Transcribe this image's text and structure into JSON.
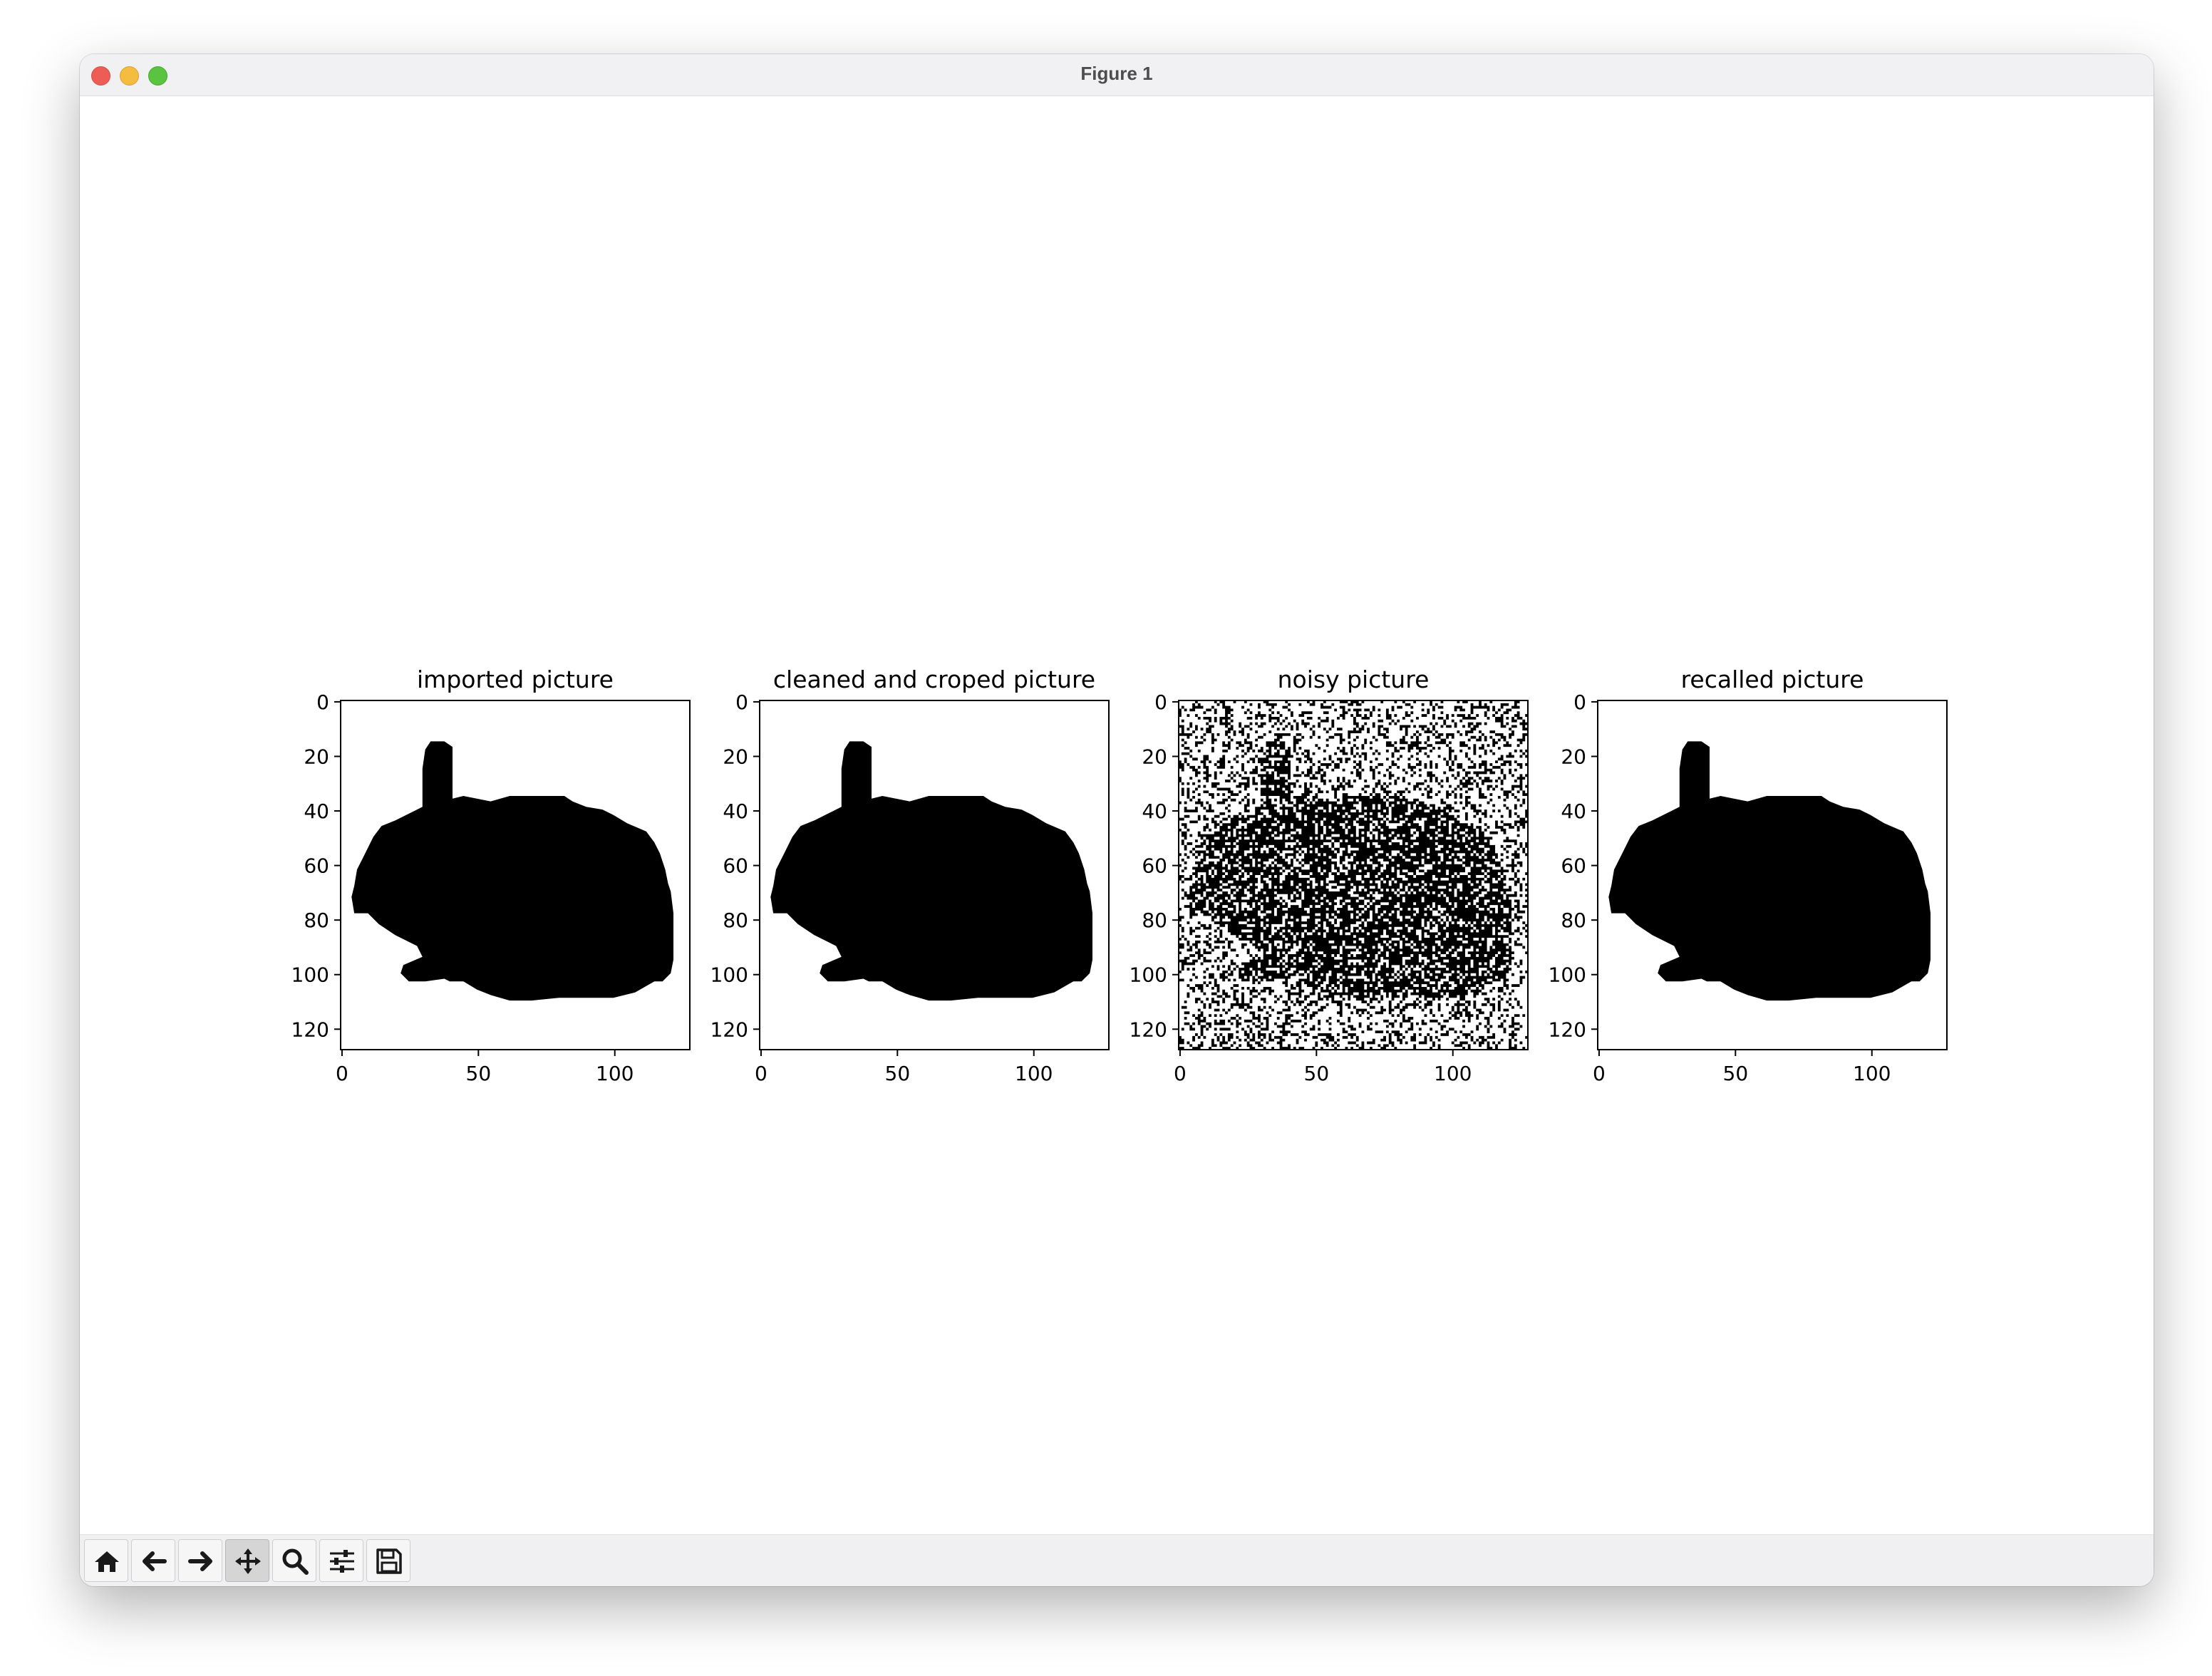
{
  "window": {
    "title": "Figure 1"
  },
  "toolbar": {
    "buttons": [
      {
        "icon": "home-icon"
      },
      {
        "icon": "back-arrow-icon"
      },
      {
        "icon": "forward-arrow-icon"
      },
      {
        "icon": "pan-icon",
        "active": true
      },
      {
        "icon": "zoom-icon"
      },
      {
        "icon": "configure-subplots-icon"
      },
      {
        "icon": "save-icon"
      }
    ]
  },
  "chart_data": [
    {
      "type": "heatmap",
      "title": "imported picture",
      "image": "rabbit silhouette",
      "xlim": [
        0,
        127
      ],
      "ylim": [
        127,
        0
      ],
      "xticks": [
        "0",
        "50",
        "100"
      ],
      "yticks": [
        "0",
        "20",
        "40",
        "60",
        "80",
        "100",
        "120"
      ]
    },
    {
      "type": "heatmap",
      "title": "cleaned and croped picture",
      "image": "rabbit silhouette",
      "xlim": [
        0,
        127
      ],
      "ylim": [
        127,
        0
      ],
      "xticks": [
        "0",
        "50",
        "100"
      ],
      "yticks": [
        "0",
        "20",
        "40",
        "60",
        "80",
        "100",
        "120"
      ]
    },
    {
      "type": "heatmap",
      "title": "noisy picture",
      "image": "rabbit silhouette with random noise",
      "xlim": [
        0,
        127
      ],
      "ylim": [
        127,
        0
      ],
      "xticks": [
        "0",
        "50",
        "100"
      ],
      "yticks": [
        "0",
        "20",
        "40",
        "60",
        "80",
        "100",
        "120"
      ]
    },
    {
      "type": "heatmap",
      "title": "recalled picture",
      "image": "rabbit silhouette",
      "xlim": [
        0,
        127
      ],
      "ylim": [
        127,
        0
      ],
      "xticks": [
        "0",
        "50",
        "100"
      ],
      "yticks": [
        "0",
        "20",
        "40",
        "60",
        "80",
        "100",
        "120"
      ]
    }
  ]
}
